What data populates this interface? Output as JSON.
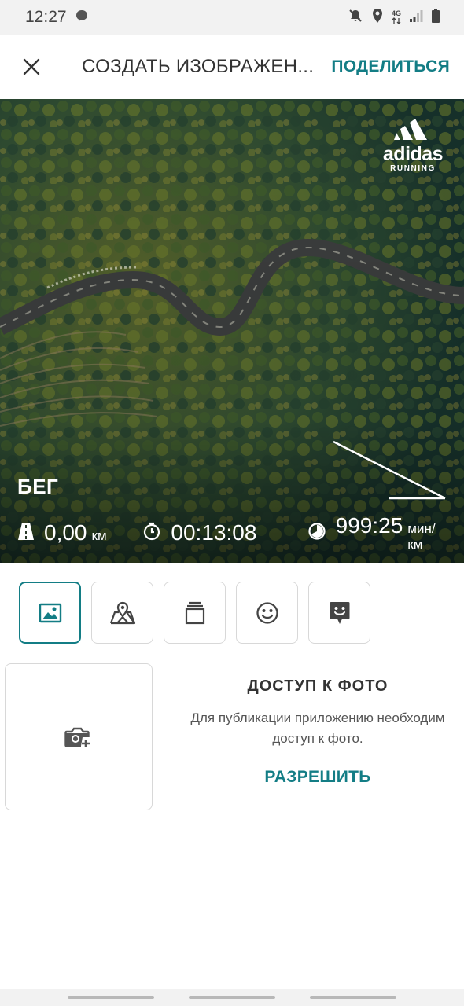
{
  "status_bar": {
    "time": "12:27",
    "network": "4G",
    "icons": [
      "messenger-icon",
      "mute-icon",
      "location-icon",
      "network-icon",
      "signal-icon",
      "battery-icon"
    ]
  },
  "app_bar": {
    "close_icon": "close-icon",
    "title": "СОЗДАТЬ ИЗОБРАЖЕН...",
    "share_label": "ПОДЕЛИТЬСЯ"
  },
  "preview": {
    "brand": {
      "name": "adidas",
      "sub": "RUNNING"
    },
    "activity": "БЕГ",
    "stats": {
      "distance_value": "0,00",
      "distance_unit": "км",
      "duration_value": "00:13:08",
      "pace_value": "999:25",
      "pace_unit": "мин/км"
    }
  },
  "tabs": [
    {
      "name": "image",
      "icon": "image-icon",
      "active": true
    },
    {
      "name": "map",
      "icon": "map-icon",
      "active": false
    },
    {
      "name": "layout",
      "icon": "layers-icon",
      "active": false
    },
    {
      "name": "stickers",
      "icon": "smiley-icon",
      "active": false
    },
    {
      "name": "sticker-add",
      "icon": "sticker-icon",
      "active": false
    }
  ],
  "photo_access": {
    "title": "ДОСТУП К ФОТО",
    "text": "Для публикации приложению необходим доступ к фото.",
    "allow_label": "РАЗРЕШИТЬ",
    "camera_icon": "camera-add-icon"
  },
  "colors": {
    "accent": "#137d85",
    "border": "#d8d8d8",
    "status_bg": "#f2f2f2"
  }
}
